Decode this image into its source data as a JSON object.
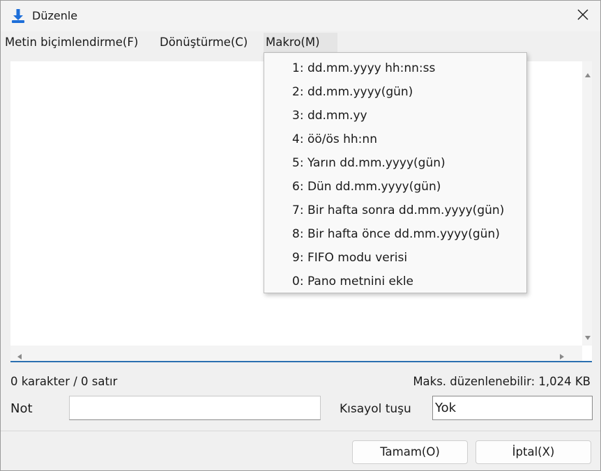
{
  "window": {
    "title": "Düzenle"
  },
  "menu": {
    "format": "Metin biçimlendirme(F)",
    "convert": "Dönüştürme(C)",
    "macro": "Makro(M)"
  },
  "macro_items": [
    "1: dd.mm.yyyy hh:nn:ss",
    "2: dd.mm.yyyy(gün)",
    "3: dd.mm.yy",
    "4: öö/ös hh:nn",
    "5: Yarın dd.mm.yyyy(gün)",
    "6: Dün dd.mm.yyyy(gün)",
    "7: Bir hafta sonra dd.mm.yyyy(gün)",
    "8: Bir hafta önce dd.mm.yyyy(gün)",
    "9: FIFO modu verisi",
    "0: Pano metnini ekle"
  ],
  "status": {
    "counts": "0 karakter / 0 satır",
    "max_editable": "Maks. düzenlenebilir: 1,024 KB"
  },
  "form": {
    "note_label": "Not",
    "note_value": "",
    "shortcut_label": "Kısayol tuşu",
    "shortcut_value": "Yok"
  },
  "buttons": {
    "ok": "Tamam(O)",
    "cancel": "İptal(X)"
  },
  "colors": {
    "accent": "#2a6fb0",
    "icon_blue": "#1e6fd9"
  },
  "icons": {
    "app": "download-arrow-icon",
    "close": "close-icon"
  }
}
